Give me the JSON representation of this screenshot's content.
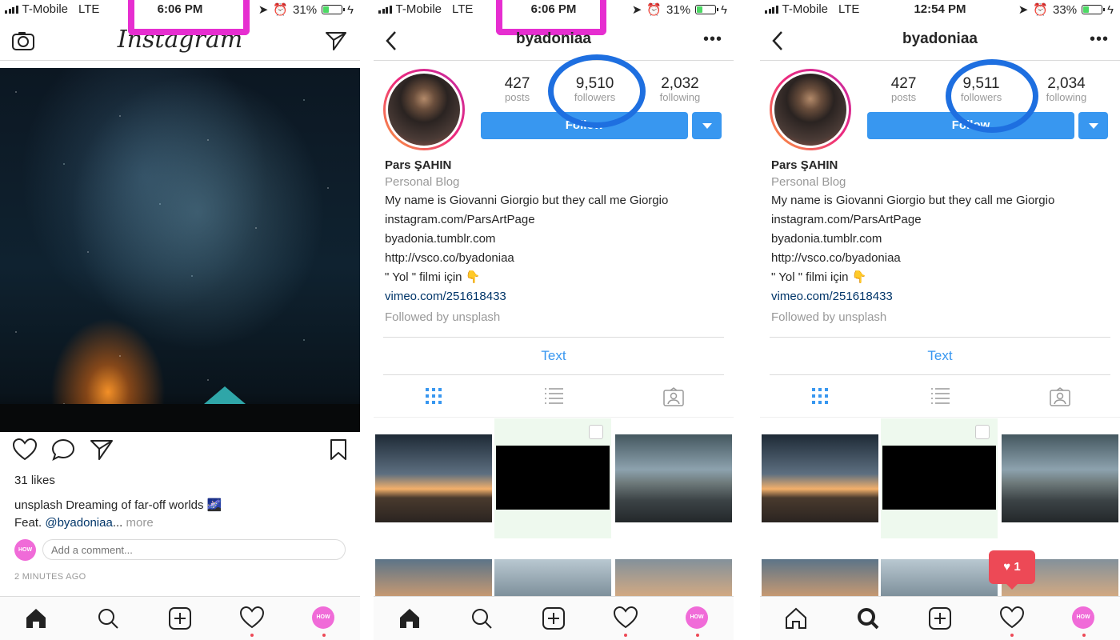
{
  "status_bars": [
    {
      "carrier": "T-Mobile",
      "network": "LTE",
      "time": "6:06 PM",
      "battery": "31%",
      "battery_level": 0.31
    },
    {
      "carrier": "T-Mobile",
      "network": "LTE",
      "time": "6:06 PM",
      "battery": "31%",
      "battery_level": 0.31
    },
    {
      "carrier": "T-Mobile",
      "network": "LTE",
      "time": "12:54 PM",
      "battery": "33%",
      "battery_level": 0.33
    }
  ],
  "feed": {
    "app_title": "Instagram",
    "likes": "31 likes",
    "caption_user": "unsplash",
    "caption_text": " Dreaming of far-off worlds ",
    "caption_feat": "Feat. ",
    "caption_mention": "@byadoniaa",
    "caption_more_ellipsis": "...",
    "caption_more": " more",
    "comment_placeholder": "Add a comment...",
    "time_ago": "2 MINUTES AGO",
    "avatar_text": "HOW"
  },
  "profiles": [
    {
      "username": "byadoniaa",
      "posts": "427",
      "posts_label": "posts",
      "followers": "9,510",
      "followers_label": "followers",
      "following": "2,032",
      "following_label": "following",
      "follow_button": "Follow",
      "name": "Pars ŞAHIN",
      "category": "Personal Blog",
      "bio": [
        "My name is Giovanni Giorgio but they call me Giorgio",
        "instagram.com/ParsArtPage",
        "byadonia.tumblr.com",
        "http://vsco.co/byadoniaa",
        "\" Yol \" filmi için 👇"
      ],
      "website": "vimeo.com/251618433",
      "followed_by": "Followed by unsplash",
      "text_button": "Text"
    },
    {
      "username": "byadoniaa",
      "posts": "427",
      "posts_label": "posts",
      "followers": "9,511",
      "followers_label": "followers",
      "following": "2,034",
      "following_label": "following",
      "follow_button": "Follow",
      "name": "Pars ŞAHIN",
      "category": "Personal Blog",
      "bio": [
        "My name is Giovanni Giorgio but they call me Giorgio",
        "instagram.com/ParsArtPage",
        "byadonia.tumblr.com",
        "http://vsco.co/byadoniaa",
        "\" Yol \" filmi için 👇"
      ],
      "website": "vimeo.com/251618433",
      "followed_by": "Followed by unsplash",
      "text_button": "Text",
      "notification_count": "1"
    }
  ],
  "nav_avatar_text": "HOW",
  "colors": {
    "accent": "#3897f0",
    "link": "#003569",
    "notification": "#ed4956",
    "annotation_pink": "#e62ed0",
    "annotation_blue": "#1e6fe0"
  },
  "icons": [
    "camera-icon",
    "direct-icon",
    "heart-icon",
    "comment-icon",
    "share-icon",
    "bookmark-icon",
    "back-icon",
    "more-icon",
    "grid-icon",
    "list-icon",
    "tagged-icon",
    "home-icon",
    "search-icon",
    "add-icon",
    "activity-icon"
  ]
}
